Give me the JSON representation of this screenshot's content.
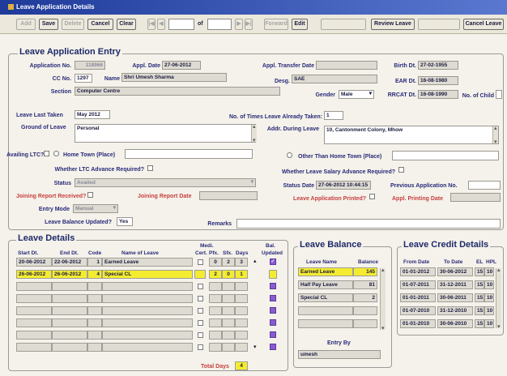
{
  "window": {
    "title": "Leave Application Details"
  },
  "toolbar": {
    "add": "Add",
    "save": "Save",
    "delete": "Delete",
    "cancel": "Cancel",
    "clear": "Clear",
    "of_label": "of",
    "forward": "Forward",
    "edit": "Edit",
    "review_leave": "Review Leave",
    "cancel_leave": "Cancel Leave"
  },
  "entry": {
    "title": "Leave Application Entry",
    "application_no_label": "Application No.",
    "application_no": "118966",
    "appl_date_label": "Appl. Date",
    "appl_date": "27-06-2012",
    "appl_transfer_date_label": "Appl. Transfer Date",
    "appl_transfer_date": "",
    "birth_dt_label": "Birth Dt.",
    "birth_dt": "27-02-1955",
    "cc_no_label": "CC No.",
    "cc_no": "1297",
    "name_label": "Name",
    "name": "Shri Umesh Sharma",
    "desg_label": "Desg.",
    "desg": "SAE",
    "ear_dt_label": "EAR Dt.",
    "ear_dt": "16-08-1980",
    "section_label": "Section",
    "section": "Computer Centre",
    "gender_label": "Gender",
    "gender": "Male",
    "rrcat_dt_label": "RRCAT Dt.",
    "rrcat_dt": "16-08-1990",
    "no_of_child_label": "No. of Child",
    "no_of_child": "",
    "leave_last_taken_label": "Leave Last Taken",
    "leave_last_taken": "May 2012",
    "times_taken_label": "No. of Times Leave Already Taken:",
    "times_taken": "1",
    "ground_label": "Ground of Leave",
    "ground": "Personal",
    "addr_label": "Addr. During Leave",
    "addr": "10, Cantonment Colony, Mhow",
    "ltc_label": "Availing LTC?",
    "home_town_label": "Home Town (Place)",
    "other_home_town_label": "Other Than Home Town (Place)",
    "ltc_advance_label": "Whether LTC Advance Required?",
    "salary_advance_label": "Whether Leave Salary Advance Required?",
    "status_label": "Status",
    "status": "Availed",
    "status_date_label": "Status Date",
    "status_date": "27-06-2012 10:44:15",
    "prev_app_label": "Previous Application No.",
    "prev_app": "",
    "joining_received_label": "Joining Report Received?",
    "joining_date_label": "Joining Report Date",
    "leave_printed_label": "Leave Application Printed?",
    "appl_printing_date_label": "Appl. Printing Date",
    "entry_mode_label": "Entry Mode",
    "entry_mode": "Manual",
    "balance_updated_label": "Leave Balance Updated?",
    "balance_updated": "Yes",
    "remarks_label": "Remarks",
    "remarks": ""
  },
  "details": {
    "title": "Leave Details",
    "headers": {
      "start": "Start Dt.",
      "end": "End Dt.",
      "code": "Code",
      "name": "Name of Leave",
      "medi": "Medi.",
      "cert": "Cert.",
      "pfx": "Pfx.",
      "sfx": "Sfx.",
      "days": "Days",
      "bal": "Bal.",
      "updated": "Updated"
    },
    "rows": [
      {
        "start": "20-06-2012",
        "end": "22-06-2012",
        "code": "1",
        "name": "Earned Leave",
        "pfx": "0",
        "sfx": "2",
        "days": "3"
      },
      {
        "start": "26-06-2012",
        "end": "26-06-2012",
        "code": "4",
        "name": "Special CL",
        "pfx": "2",
        "sfx": "0",
        "days": "1"
      }
    ],
    "total_days_label": "Total Days",
    "total_days": "4"
  },
  "balance": {
    "title": "Leave Balance",
    "headers": {
      "name": "Leave Name",
      "bal": "Balance"
    },
    "rows": [
      {
        "name": "Earned Leave",
        "bal": "145"
      },
      {
        "name": "Half Pay Leave",
        "bal": "81"
      },
      {
        "name": "Special CL",
        "bal": "2"
      }
    ],
    "entry_by_label": "Entry By",
    "entry_by": "umesh"
  },
  "credit": {
    "title": "Leave Credit Details",
    "headers": {
      "from": "From Date",
      "to": "To Date",
      "el": "EL",
      "hpl": "HPL"
    },
    "rows": [
      {
        "from": "01-01-2012",
        "to": "30-06-2012",
        "el": "15",
        "hpl": "10"
      },
      {
        "from": "01-07-2011",
        "to": "31-12-2011",
        "el": "15",
        "hpl": "10"
      },
      {
        "from": "01-01-2011",
        "to": "30-06-2011",
        "el": "15",
        "hpl": "10"
      },
      {
        "from": "01-07-2010",
        "to": "31-12-2010",
        "el": "15",
        "hpl": "10"
      },
      {
        "from": "01-01-2010",
        "to": "30-06-2010",
        "el": "15",
        "hpl": "10"
      }
    ]
  }
}
